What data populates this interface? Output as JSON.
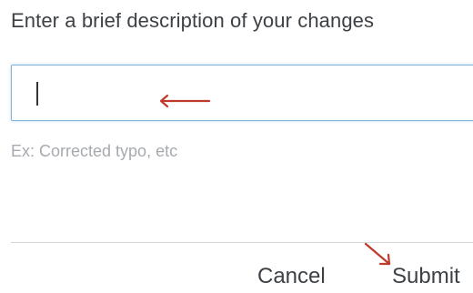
{
  "form": {
    "label": "Enter a brief description of your changes",
    "input_value": "",
    "hint": "Ex: Corrected typo, etc"
  },
  "actions": {
    "cancel_label": "Cancel",
    "submit_label": "Submit"
  },
  "colors": {
    "focus_border": "#7fb2dc",
    "annotation_arrow": "#c0392b",
    "text": "#3d4146",
    "hint": "#a6aaaf",
    "divider": "#d2d5d8"
  },
  "annotations": {
    "arrow_icons": [
      "left-arrow-icon",
      "diagonal-arrow-icon"
    ]
  }
}
